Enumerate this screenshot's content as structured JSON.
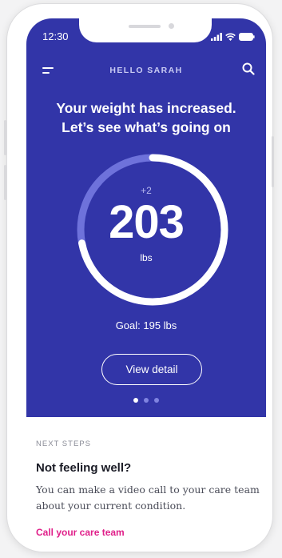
{
  "status": {
    "time": "12:30"
  },
  "header": {
    "greeting": "HELLO SARAH"
  },
  "hero": {
    "headline_line1": "Your weight has increased.",
    "headline_line2": "Let’s see what’s going on",
    "delta": "+2",
    "weight": "203",
    "unit": "lbs",
    "goal": "Goal: 195 lbs",
    "progress_fraction": 0.72,
    "button_label": "View detail",
    "pager": {
      "count": 3,
      "active": 0
    }
  },
  "next_steps": {
    "eyebrow": "NEXT STEPS",
    "title": "Not feeling well?",
    "body": "You can make a video call to your care team about your current condition.",
    "link": "Call your care team"
  },
  "colors": {
    "primary": "#3235a8",
    "ring_track": "#6e72db",
    "ring_fill": "#ffffff",
    "accent_link": "#e0208a"
  },
  "icons": {
    "menu": "menu-icon",
    "search": "search-icon",
    "signal": "signal-icon",
    "wifi": "wifi-icon",
    "battery": "battery-icon"
  }
}
